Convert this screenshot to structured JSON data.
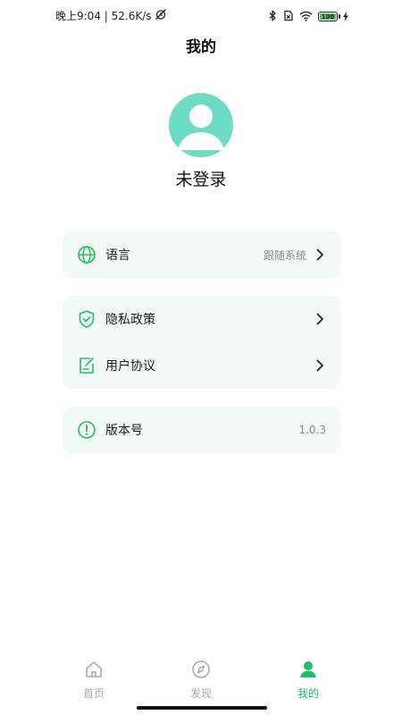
{
  "status_bar": {
    "time_text": "晚上9:04 | 52.6K/s",
    "battery_level": "100"
  },
  "header": {
    "title": "我的"
  },
  "profile": {
    "login_status": "未登录"
  },
  "settings": {
    "language": {
      "label": "语言",
      "value": "跟随系统"
    },
    "privacy_policy": {
      "label": "隐私政策"
    },
    "user_agreement": {
      "label": "用户协议"
    },
    "version": {
      "label": "版本号",
      "value": "1.0.3"
    }
  },
  "tabbar": {
    "home": {
      "label": "首页"
    },
    "discover": {
      "label": "发现"
    },
    "mine": {
      "label": "我的"
    }
  },
  "colors": {
    "accent": "#1fbf63",
    "avatar": "#6ddcc4",
    "card_bg": "#f2f9f6",
    "inactive": "#aaaaaa"
  }
}
